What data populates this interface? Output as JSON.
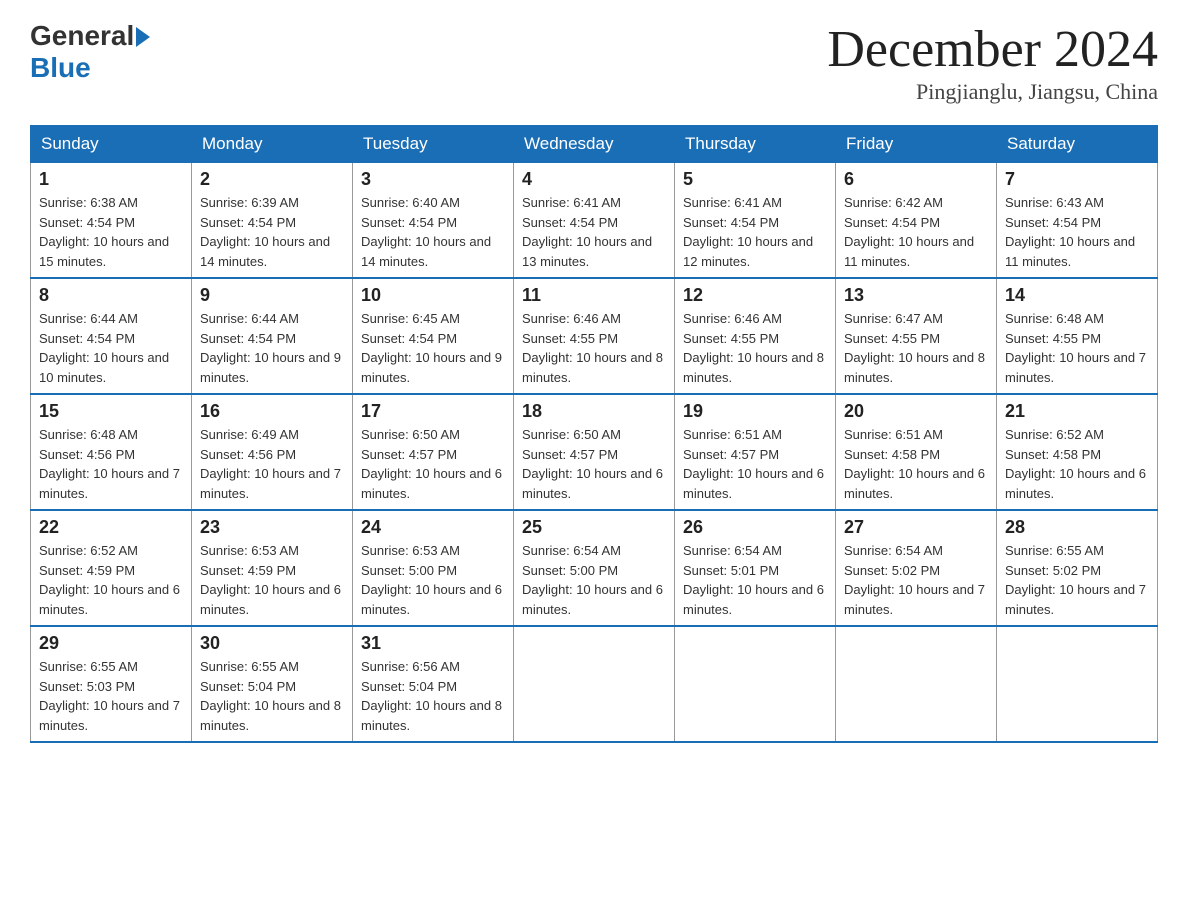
{
  "logo": {
    "general": "General",
    "blue": "Blue"
  },
  "title": "December 2024",
  "location": "Pingjianglu, Jiangsu, China",
  "days_of_week": [
    "Sunday",
    "Monday",
    "Tuesday",
    "Wednesday",
    "Thursday",
    "Friday",
    "Saturday"
  ],
  "weeks": [
    [
      {
        "day": "1",
        "sunrise": "6:38 AM",
        "sunset": "4:54 PM",
        "daylight": "10 hours and 15 minutes."
      },
      {
        "day": "2",
        "sunrise": "6:39 AM",
        "sunset": "4:54 PM",
        "daylight": "10 hours and 14 minutes."
      },
      {
        "day": "3",
        "sunrise": "6:40 AM",
        "sunset": "4:54 PM",
        "daylight": "10 hours and 14 minutes."
      },
      {
        "day": "4",
        "sunrise": "6:41 AM",
        "sunset": "4:54 PM",
        "daylight": "10 hours and 13 minutes."
      },
      {
        "day": "5",
        "sunrise": "6:41 AM",
        "sunset": "4:54 PM",
        "daylight": "10 hours and 12 minutes."
      },
      {
        "day": "6",
        "sunrise": "6:42 AM",
        "sunset": "4:54 PM",
        "daylight": "10 hours and 11 minutes."
      },
      {
        "day": "7",
        "sunrise": "6:43 AM",
        "sunset": "4:54 PM",
        "daylight": "10 hours and 11 minutes."
      }
    ],
    [
      {
        "day": "8",
        "sunrise": "6:44 AM",
        "sunset": "4:54 PM",
        "daylight": "10 hours and 10 minutes."
      },
      {
        "day": "9",
        "sunrise": "6:44 AM",
        "sunset": "4:54 PM",
        "daylight": "10 hours and 9 minutes."
      },
      {
        "day": "10",
        "sunrise": "6:45 AM",
        "sunset": "4:54 PM",
        "daylight": "10 hours and 9 minutes."
      },
      {
        "day": "11",
        "sunrise": "6:46 AM",
        "sunset": "4:55 PM",
        "daylight": "10 hours and 8 minutes."
      },
      {
        "day": "12",
        "sunrise": "6:46 AM",
        "sunset": "4:55 PM",
        "daylight": "10 hours and 8 minutes."
      },
      {
        "day": "13",
        "sunrise": "6:47 AM",
        "sunset": "4:55 PM",
        "daylight": "10 hours and 8 minutes."
      },
      {
        "day": "14",
        "sunrise": "6:48 AM",
        "sunset": "4:55 PM",
        "daylight": "10 hours and 7 minutes."
      }
    ],
    [
      {
        "day": "15",
        "sunrise": "6:48 AM",
        "sunset": "4:56 PM",
        "daylight": "10 hours and 7 minutes."
      },
      {
        "day": "16",
        "sunrise": "6:49 AM",
        "sunset": "4:56 PM",
        "daylight": "10 hours and 7 minutes."
      },
      {
        "day": "17",
        "sunrise": "6:50 AM",
        "sunset": "4:57 PM",
        "daylight": "10 hours and 6 minutes."
      },
      {
        "day": "18",
        "sunrise": "6:50 AM",
        "sunset": "4:57 PM",
        "daylight": "10 hours and 6 minutes."
      },
      {
        "day": "19",
        "sunrise": "6:51 AM",
        "sunset": "4:57 PM",
        "daylight": "10 hours and 6 minutes."
      },
      {
        "day": "20",
        "sunrise": "6:51 AM",
        "sunset": "4:58 PM",
        "daylight": "10 hours and 6 minutes."
      },
      {
        "day": "21",
        "sunrise": "6:52 AM",
        "sunset": "4:58 PM",
        "daylight": "10 hours and 6 minutes."
      }
    ],
    [
      {
        "day": "22",
        "sunrise": "6:52 AM",
        "sunset": "4:59 PM",
        "daylight": "10 hours and 6 minutes."
      },
      {
        "day": "23",
        "sunrise": "6:53 AM",
        "sunset": "4:59 PM",
        "daylight": "10 hours and 6 minutes."
      },
      {
        "day": "24",
        "sunrise": "6:53 AM",
        "sunset": "5:00 PM",
        "daylight": "10 hours and 6 minutes."
      },
      {
        "day": "25",
        "sunrise": "6:54 AM",
        "sunset": "5:00 PM",
        "daylight": "10 hours and 6 minutes."
      },
      {
        "day": "26",
        "sunrise": "6:54 AM",
        "sunset": "5:01 PM",
        "daylight": "10 hours and 6 minutes."
      },
      {
        "day": "27",
        "sunrise": "6:54 AM",
        "sunset": "5:02 PM",
        "daylight": "10 hours and 7 minutes."
      },
      {
        "day": "28",
        "sunrise": "6:55 AM",
        "sunset": "5:02 PM",
        "daylight": "10 hours and 7 minutes."
      }
    ],
    [
      {
        "day": "29",
        "sunrise": "6:55 AM",
        "sunset": "5:03 PM",
        "daylight": "10 hours and 7 minutes."
      },
      {
        "day": "30",
        "sunrise": "6:55 AM",
        "sunset": "5:04 PM",
        "daylight": "10 hours and 8 minutes."
      },
      {
        "day": "31",
        "sunrise": "6:56 AM",
        "sunset": "5:04 PM",
        "daylight": "10 hours and 8 minutes."
      },
      null,
      null,
      null,
      null
    ]
  ]
}
